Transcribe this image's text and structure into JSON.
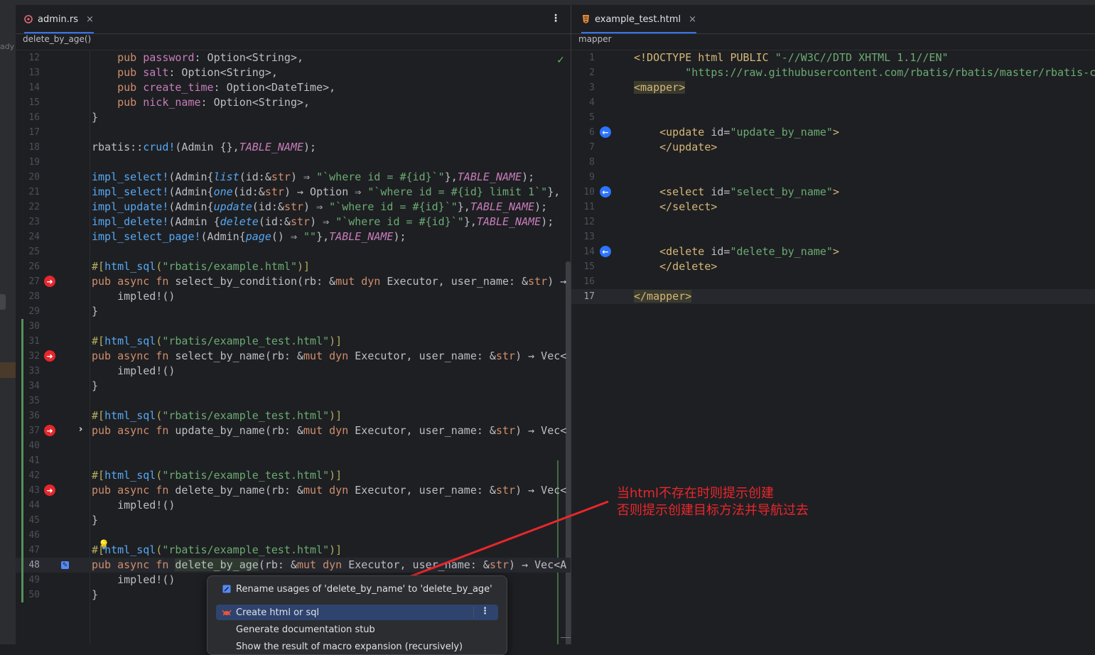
{
  "left_tab": {
    "name": "admin.rs",
    "close": "×"
  },
  "right_tab": {
    "name": "example_test.html",
    "close": "×"
  },
  "left_breadcrumb": "delete_by_age()",
  "right_breadcrumb": "mapper",
  "sidebar_text": "ady",
  "left_lines": [
    {
      "n": "12",
      "html": "    <span class='k'>pub</span> <span class='v'>password</span>: Option&lt;String&gt;,"
    },
    {
      "n": "13",
      "html": "    <span class='k'>pub</span> <span class='v'>salt</span>: Option&lt;String&gt;,"
    },
    {
      "n": "14",
      "html": "    <span class='k'>pub</span> <span class='v'>create_time</span>: Option&lt;DateTime&gt;,"
    },
    {
      "n": "15",
      "html": "    <span class='k'>pub</span> <span class='v'>nick_name</span>: Option&lt;String&gt;,"
    },
    {
      "n": "16",
      "html": "}"
    },
    {
      "n": "17",
      "html": ""
    },
    {
      "n": "18",
      "html": "rbatis::<span class='mc'>crud!</span>(Admin {},<span class='c'>TABLE_NAME</span>);"
    },
    {
      "n": "19",
      "html": ""
    },
    {
      "n": "20",
      "html": "<span class='mc'>impl_select!</span>(Admin{<span class='fi'>list</span>(id:&amp;<span class='k'>str</span>) ⇒ <span class='s'>\"`where id = #{id}`\"</span>},<span class='c'>TABLE_NAME</span>);"
    },
    {
      "n": "21",
      "html": "<span class='mc'>impl_select!</span>(Admin{<span class='fi'>one</span>(id:&amp;<span class='k'>str</span>) → Option ⇒ <span class='s'>\"`where id = #{id} limit 1`\"</span>},"
    },
    {
      "n": "22",
      "html": "<span class='mc'>impl_update!</span>(Admin{<span class='fi'>update</span>(id:&amp;<span class='k'>str</span>) ⇒ <span class='s'>\"`where id = #{id}`\"</span>},<span class='c'>TABLE_NAME</span>);"
    },
    {
      "n": "23",
      "html": "<span class='mc'>impl_delete!</span>(Admin {<span class='fi'>delete</span>(id:&amp;<span class='k'>str</span>) ⇒ <span class='s'>\"`where id = #{id}`\"</span>},<span class='c'>TABLE_NAME</span>);"
    },
    {
      "n": "24",
      "html": "<span class='mc'>impl_select_page!</span>(Admin{<span class='fi'>page</span>() ⇒ <span class='s'>\"\"</span>},<span class='c'>TABLE_NAME</span>);"
    },
    {
      "n": "25",
      "html": ""
    },
    {
      "n": "26",
      "html": "<span class='a'>#[</span><span class='f'>html_sql</span><span class='a'>(</span><span class='s'>\"rbatis/example.html\"</span><span class='a'>)]</span>"
    },
    {
      "n": "27",
      "html": "<span class='k'>pub async fn</span> <span class='fd'>select_by_condition</span>(rb: &amp;<span class='k'>mut dyn</span> Executor, user_name: &amp;<span class='k'>str</span>) →"
    },
    {
      "n": "28",
      "html": "    impled!()"
    },
    {
      "n": "29",
      "html": "}"
    },
    {
      "n": "30",
      "html": ""
    },
    {
      "n": "31",
      "html": "<span class='a'>#[</span><span class='f'>html_sql</span><span class='a'>(</span><span class='s'>\"rbatis/example_test.html\"</span><span class='a'>)]</span>"
    },
    {
      "n": "32",
      "html": "<span class='k'>pub async fn</span> <span class='fd'>select_by_name</span>(rb: &amp;<span class='k'>mut dyn</span> Executor, user_name: &amp;<span class='k'>str</span>) → Vec&lt;"
    },
    {
      "n": "33",
      "html": "    impled!()"
    },
    {
      "n": "34",
      "html": "}"
    },
    {
      "n": "35",
      "html": ""
    },
    {
      "n": "36",
      "html": "<span class='a'>#[</span><span class='f'>html_sql</span><span class='a'>(</span><span class='s'>\"rbatis/example_test.html\"</span><span class='a'>)]</span>"
    },
    {
      "n": "37",
      "html": "<span class='k'>pub async fn</span> <span class='fd'>update_by_name</span>(rb: &amp;<span class='k'>mut dyn</span> Executor, user_name: &amp;<span class='k'>str</span>) → Vec&lt;"
    },
    {
      "n": "40",
      "html": ""
    },
    {
      "n": "41",
      "html": ""
    },
    {
      "n": "42",
      "html": "<span class='a'>#[</span><span class='f'>html_sql</span><span class='a'>(</span><span class='s'>\"rbatis/example_test.html\"</span><span class='a'>)]</span>"
    },
    {
      "n": "43",
      "html": "<span class='k'>pub async fn</span> <span class='fd'>delete_by_name</span>(rb: &amp;<span class='k'>mut dyn</span> Executor, user_name: &amp;<span class='k'>str</span>) → Vec&lt;"
    },
    {
      "n": "44",
      "html": "    impled!()"
    },
    {
      "n": "45",
      "html": "}"
    },
    {
      "n": "46",
      "html": ""
    },
    {
      "n": "47",
      "html": "<span class='a'>#[</span><span class='f'>html_sql</span><span class='a'>(</span><span class='s'>\"rbatis/example_test.html\"</span><span class='a'>)]</span>"
    },
    {
      "n": "48",
      "html": "<span class='k'>pub async fn</span> <span class='hl'>delete_by_age</span>(rb: &amp;<span class='k'>mut dyn</span> Executor, user_name: &amp;<span class='k'>str</span>) → Vec&lt;A"
    },
    {
      "n": "49",
      "html": "    impled!()"
    },
    {
      "n": "50",
      "html": "}"
    }
  ],
  "right_lines": [
    {
      "n": "1",
      "html": "<span class='t'>&lt;!DOCTYPE html PUBLIC </span><span class='s'>\"-//W3C//DTD XHTML 1.1//EN\"</span>"
    },
    {
      "n": "2",
      "html": "        <span class='s'>\"https://raw.githubusercontent.com/rbatis/rbatis/master/rbatis-c</span>"
    },
    {
      "n": "3",
      "html": "<span class='tb'>&lt;mapper&gt;</span>"
    },
    {
      "n": "4",
      "html": ""
    },
    {
      "n": "5",
      "html": ""
    },
    {
      "n": "6",
      "html": "    <span class='t'>&lt;update </span><span class='at'>id=</span><span class='s'>\"update_by_name\"</span><span class='t'>&gt;</span>"
    },
    {
      "n": "7",
      "html": "    <span class='t'>&lt;/update&gt;</span>"
    },
    {
      "n": "8",
      "html": ""
    },
    {
      "n": "9",
      "html": ""
    },
    {
      "n": "10",
      "html": "    <span class='t'>&lt;select </span><span class='at'>id=</span><span class='s'>\"select_by_name\"</span><span class='t'>&gt;</span>"
    },
    {
      "n": "11",
      "html": "    <span class='t'>&lt;/select&gt;</span>"
    },
    {
      "n": "12",
      "html": ""
    },
    {
      "n": "13",
      "html": ""
    },
    {
      "n": "14",
      "html": "    <span class='t'>&lt;delete </span><span class='at'>id=</span><span class='s'>\"delete_by_name\"</span><span class='t'>&gt;</span>"
    },
    {
      "n": "15",
      "html": "    <span class='t'>&lt;/delete&gt;</span>"
    },
    {
      "n": "16",
      "html": ""
    },
    {
      "n": "17",
      "html": "<span class='tb'>&lt;/mapper&gt;</span>"
    }
  ],
  "annotation": {
    "line1": "当html不存在时则提示创建",
    "line2": "否则提示创建目标方法并导航过去"
  },
  "popup": {
    "item_rename": "Rename usages of 'delete_by_name' to 'delete_by_age'",
    "item_create": "Create html or sql",
    "item_doc": "Generate documentation stub",
    "item_more": "Show the result of macro expansion (recursively)"
  },
  "colors": {
    "accent": "#3574f0",
    "annotation": "#e8272d",
    "gutter_red": "#e5282e",
    "gutter_blue": "#2d74ff",
    "vcs_green": "#549159"
  }
}
